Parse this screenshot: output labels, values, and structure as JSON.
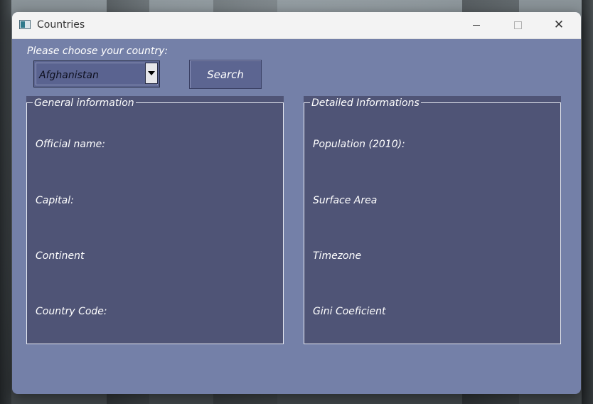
{
  "window": {
    "title": "Countries"
  },
  "controls": {
    "prompt": "Please choose your country:",
    "country_select": {
      "value": "Afghanistan"
    },
    "search_label": "Search"
  },
  "general": {
    "title": "General information",
    "fields": [
      "Official name:",
      "Capital:",
      "Continent",
      "Country Code:"
    ]
  },
  "detailed": {
    "title": "Detailed Informations",
    "fields": [
      "Population (2010):",
      "Surface Area",
      "Timezone",
      "Gini Coeficient"
    ]
  },
  "icons": {
    "app": "window-app-icon",
    "minimize": "minimize-icon",
    "maximize": "maximize-icon",
    "close": "close-icon",
    "dropdown": "chevron-down-icon"
  },
  "colors": {
    "window_bg": "#7480a8",
    "panel_bg": "#4f5476",
    "text": "#ffffff"
  }
}
